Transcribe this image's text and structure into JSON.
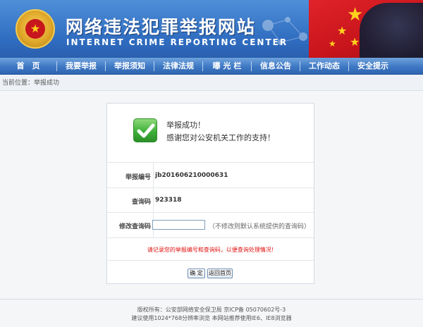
{
  "header": {
    "title": "网络违法犯罪举报网站",
    "subtitle": "INTERNET CRIME REPORTING CENTER"
  },
  "nav": {
    "items": [
      {
        "label": "首　页"
      },
      {
        "label": "我要举报"
      },
      {
        "label": "举报须知"
      },
      {
        "label": "法律法规"
      },
      {
        "label": "曝 光 栏"
      },
      {
        "label": "信息公告"
      },
      {
        "label": "工作动态"
      },
      {
        "label": "安全提示"
      }
    ]
  },
  "breadcrumb": {
    "text": "当前位置：举报成功"
  },
  "result": {
    "title": "举报成功！",
    "message": "感谢您对公安机关工作的支持！",
    "report_number_label": "举报编号",
    "report_number": "jb201606210000631",
    "query_code_label": "查询码",
    "query_code": "923318",
    "modify_label": "修改查询码",
    "modify_value": "",
    "modify_note": "（不修改则默认系统提供的查询码）",
    "warning": "请记录您的举报编号和查询码，以便查询处理情况!"
  },
  "buttons": {
    "confirm": "确 定",
    "home": "返回首页"
  },
  "footer": {
    "line1": "版权所有：公安部网络安全保卫局 京ICP备 05070602号-3",
    "line2": "建议使用1024*768分辨率浏览 本网站推荐使用IE6、IE8浏览器"
  },
  "colors": {
    "nav_bg": "#3e78c4",
    "warning": "#e01010",
    "success_green": "#3fb13a"
  }
}
